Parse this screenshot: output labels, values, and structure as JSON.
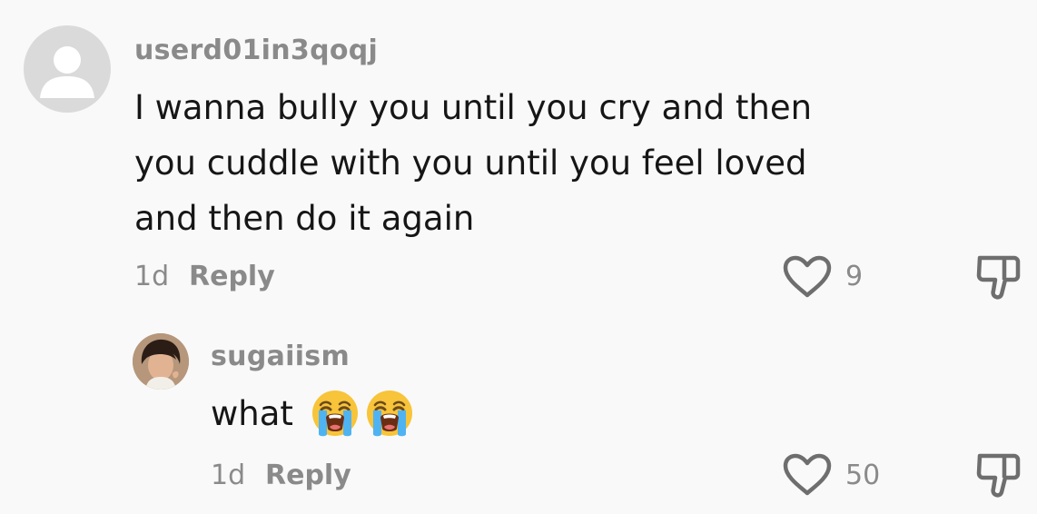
{
  "comments": [
    {
      "username": "userd01in3qoqj",
      "text_lines": [
        "I wanna bully you until you cry and then",
        "you cuddle with you until you feel loved",
        "and then do it again"
      ],
      "time": "1d",
      "reply_label": "Reply",
      "like_count": "9",
      "avatar": "default-avatar-icon"
    },
    {
      "username": "sugaiism",
      "text": "what",
      "emojis": [
        "loudly-crying-face-emoji",
        "loudly-crying-face-emoji"
      ],
      "time": "1d",
      "reply_label": "Reply",
      "like_count": "50",
      "avatar": "user-photo"
    }
  ],
  "colors": {
    "background": "#f9f9f9",
    "text": "#161616",
    "muted": "#8a8a8a",
    "icon": "#6e6e6e"
  }
}
